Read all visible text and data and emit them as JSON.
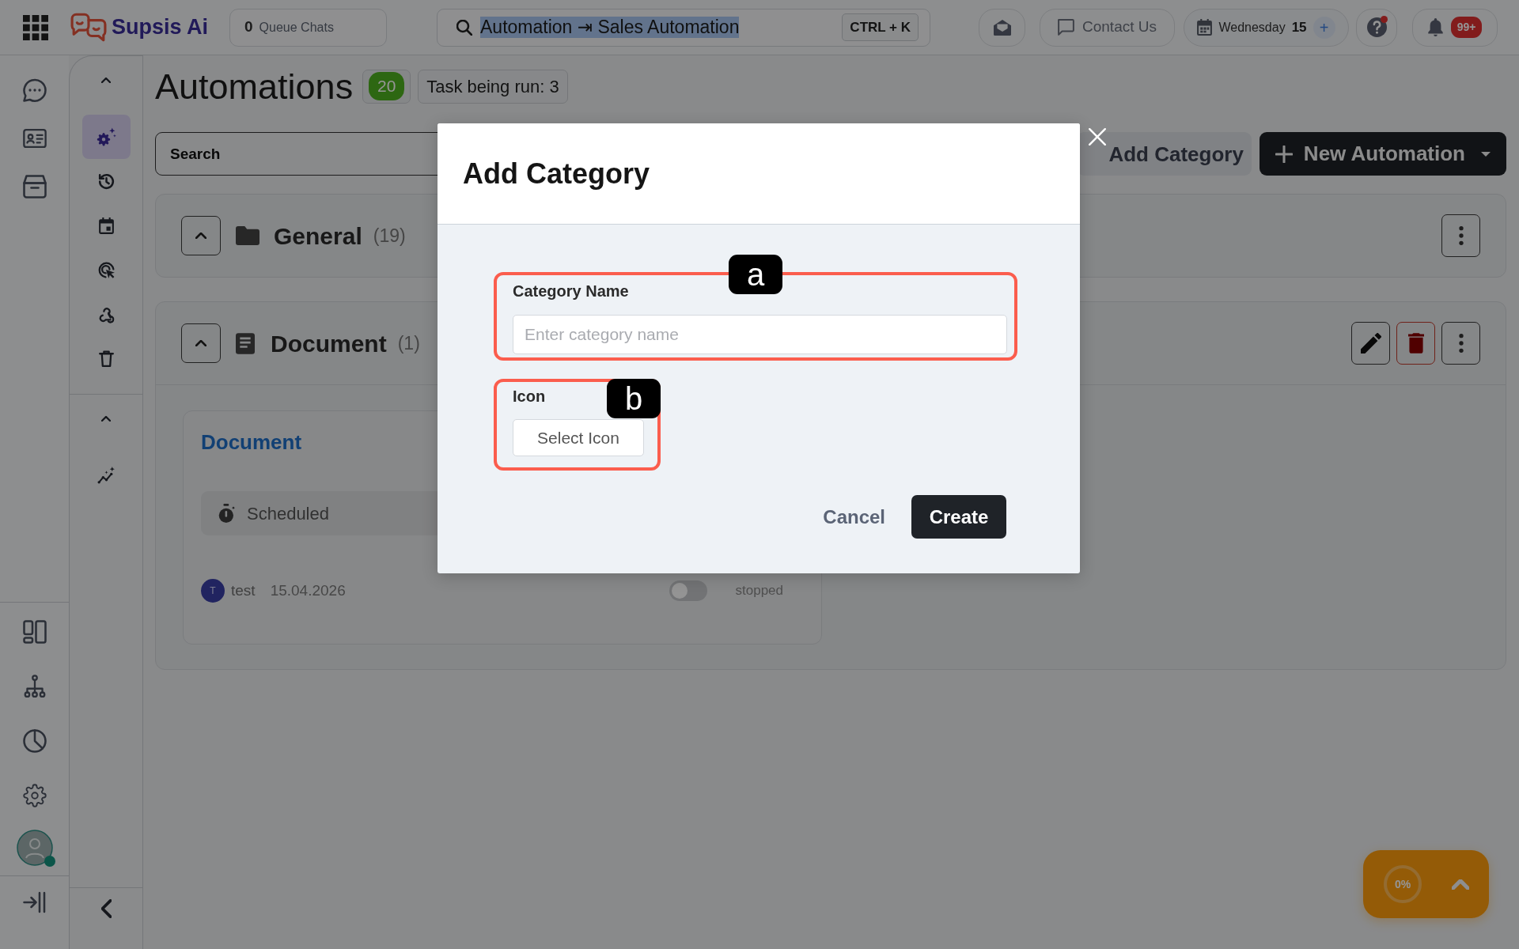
{
  "top_bar": {
    "logo": "Supsis Ai",
    "queue": {
      "count": "0",
      "label": "Queue Chats"
    },
    "search": {
      "value": "Automation ⇥ Sales Automation",
      "value_selected": true,
      "shortcut": "CTRL + K"
    },
    "contact": "Contact Us",
    "date": {
      "weekday": "Wednesday",
      "day": "15",
      "add": "+"
    },
    "help": {
      "alert": true
    },
    "notifications": {
      "badge": "99+"
    }
  },
  "rail": {
    "user": {
      "online": true
    }
  },
  "sub_nav": {
    "groups": [
      {
        "expanded": true,
        "items": [
          {
            "selected": true
          },
          {
            "selected": false
          },
          {
            "selected": false
          },
          {
            "selected": false
          },
          {
            "selected": false
          },
          {
            "selected": false
          }
        ]
      },
      {
        "expanded": true,
        "items": [
          {
            "selected": false
          }
        ]
      }
    ]
  },
  "page": {
    "title": "Automations",
    "count": "20",
    "running": "Task being run: 3",
    "search": {
      "placeholder": "Search"
    },
    "add_category": "Add Category",
    "new_automation": "New Automation"
  },
  "categories": [
    {
      "kind": "default",
      "name": "General",
      "count": "(19)"
    },
    {
      "kind": "custom",
      "name": "Document",
      "count": "(1)",
      "automations": [
        {
          "title": "Document",
          "trigger": "Scheduled",
          "owner_initial": "T",
          "owner": "test",
          "date": "15.04.2026",
          "running": false,
          "status": "stopped"
        }
      ]
    }
  ],
  "modal": {
    "title": "Add Category",
    "fields": [
      {
        "kind": "text",
        "label": "Category Name",
        "placeholder": "Enter category name",
        "callout": "a"
      },
      {
        "kind": "icon_picker",
        "label": "Icon",
        "button": "Select Icon",
        "callout": "b"
      }
    ],
    "buttons": [
      {
        "kind": "secondary",
        "label": "Cancel"
      },
      {
        "kind": "primary",
        "label": "Create"
      }
    ]
  },
  "progress_widget": {
    "label": "0%",
    "level": 0
  }
}
